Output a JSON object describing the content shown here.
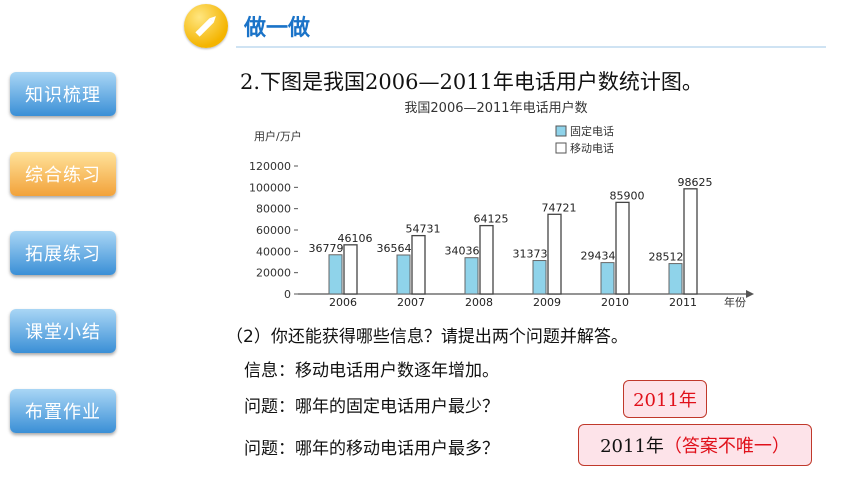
{
  "header": {
    "title": "做一做"
  },
  "sidebar": {
    "items": [
      {
        "label": "知识梳理",
        "active": false
      },
      {
        "label": "综合练习",
        "active": true
      },
      {
        "label": "拓展练习",
        "active": false
      },
      {
        "label": "课堂小结",
        "active": false
      },
      {
        "label": "布置作业",
        "active": false
      }
    ]
  },
  "question": "2.下图是我国2006—2011年电话用户数统计图。",
  "chart_data": {
    "type": "bar",
    "title": "我国2006—2011年电话用户数",
    "ylabel": "用户/万户",
    "xlabel": "年份",
    "ylim": [
      0,
      120000
    ],
    "yticks": [
      "120000",
      "100000",
      "80000",
      "60000",
      "40000",
      "20000",
      "0"
    ],
    "categories": [
      "2006",
      "2007",
      "2008",
      "2009",
      "2010",
      "2011"
    ],
    "series": [
      {
        "name": "固定电话",
        "values": [
          36779,
          36564,
          34036,
          31373,
          29434,
          28512
        ],
        "color": "#8fd3ea"
      },
      {
        "name": "移动电话",
        "values": [
          46106,
          54731,
          64125,
          74721,
          85900,
          98625
        ],
        "color": "#ffffff"
      }
    ]
  },
  "sub_question": "（2）你还能获得哪些信息？请提出两个问题并解答。",
  "info_line": "信息：移动电话用户数逐年增加。",
  "q1": "问题：哪年的固定电话用户最少？",
  "a1": "2011年",
  "q2": "问题：哪年的移动电话用户最多？",
  "a2_year": "2011年",
  "a2_note": "（答案不唯一）",
  "colors": {
    "accent": "#1a73c8",
    "answer_red": "#e0101a"
  }
}
